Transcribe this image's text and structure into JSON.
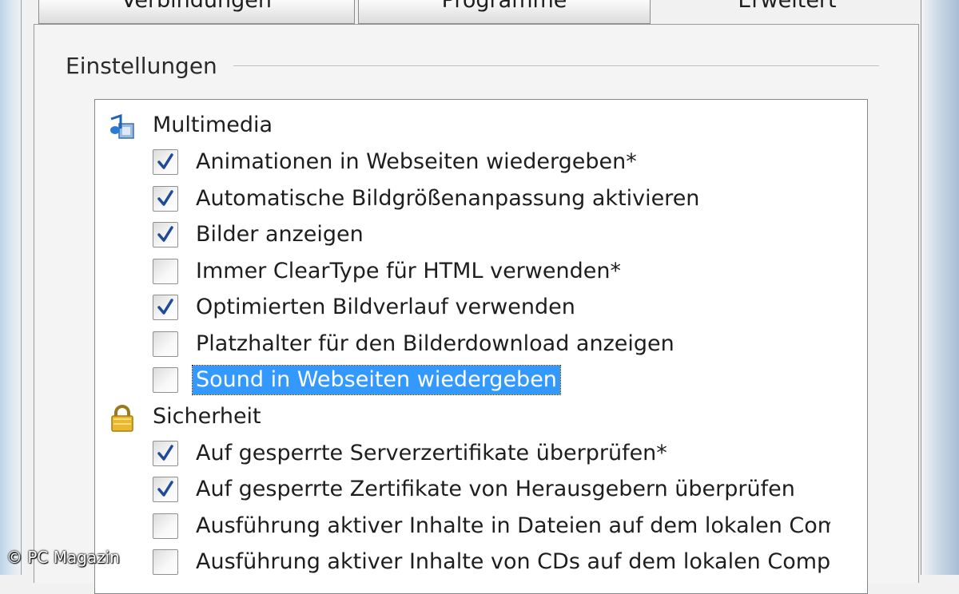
{
  "tabs": {
    "connections": "Verbindungen",
    "programs": "Programme",
    "advanced": "Erweitert"
  },
  "group": {
    "title": "Einstellungen"
  },
  "categories": [
    {
      "label": "Multimedia",
      "icon": "multimedia-icon",
      "items": [
        {
          "label": "Animationen in Webseiten wiedergeben*",
          "checked": true
        },
        {
          "label": "Automatische Bildgrößenanpassung aktivieren",
          "checked": true
        },
        {
          "label": "Bilder anzeigen",
          "checked": true
        },
        {
          "label": "Immer ClearType für HTML verwenden*",
          "checked": false
        },
        {
          "label": "Optimierten Bildverlauf verwenden",
          "checked": true
        },
        {
          "label": "Platzhalter für den Bilderdownload anzeigen",
          "checked": false
        },
        {
          "label": "Sound in Webseiten wiedergeben",
          "checked": false,
          "selected": true
        }
      ]
    },
    {
      "label": "Sicherheit",
      "icon": "lock-icon",
      "items": [
        {
          "label": "Auf gesperrte Serverzertifikate überprüfen*",
          "checked": true
        },
        {
          "label": "Auf gesperrte Zertifikate von Herausgebern überprüfen",
          "checked": true
        },
        {
          "label": "Ausführung aktiver Inhalte in Dateien auf dem lokalen Computer zulassen",
          "checked": false
        },
        {
          "label": "Ausführung aktiver Inhalte von CDs auf dem lokalen Computer zulassen",
          "checked": false
        }
      ]
    }
  ],
  "scrollbar": {
    "up_arrow": "▲"
  },
  "watermark": "© PC Magazin",
  "colors": {
    "selection": "#3399ff",
    "check": "#1f4a96",
    "window_frame": "#bcd3e8"
  }
}
